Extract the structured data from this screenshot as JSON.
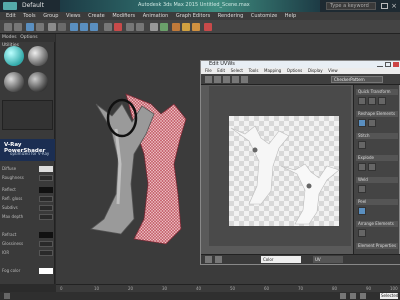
{
  "app": {
    "title": "Default",
    "window_title": "Autodesk 3ds Max 2015  Untitled_Scene.max",
    "search_placeholder": "Type a keyword"
  },
  "menubar": {
    "items": [
      "Edit",
      "Tools",
      "Group",
      "Views",
      "Create",
      "Modifiers",
      "Animation",
      "Graph Editors",
      "Rendering",
      "Customize",
      "Help"
    ]
  },
  "material_panel": {
    "tabs": [
      "Modes",
      "Options",
      "Utilities"
    ],
    "vray_title": "V-Ray PowerShader",
    "vray_subtitle": "optimized for V-Ray",
    "params": [
      "Diffuse",
      "Roughness",
      "Reflect",
      "Refl. gloss",
      "Subdivs",
      "Max depth",
      "Refract",
      "Glossiness",
      "IOR",
      "Fog color"
    ]
  },
  "uv_editor": {
    "title": "Edit UVWs",
    "menus": [
      "File",
      "Edit",
      "Select",
      "Tools",
      "Mapping",
      "Options",
      "Display",
      "View"
    ],
    "dropdown_value": "CheckerPattern",
    "status_value": "Color",
    "zoom_value": "UV",
    "side_sections": [
      "Quick Transform",
      "Reshape Elements",
      "Stitch",
      "Explode",
      "Weld",
      "Peel",
      "Arrange Elements",
      "Element Properties"
    ]
  },
  "timeline": {
    "ticks": [
      "0",
      "10",
      "20",
      "30",
      "40",
      "50",
      "60",
      "70",
      "80",
      "90",
      "100"
    ]
  },
  "statusbar": {
    "field": "Selected"
  },
  "colors": {
    "accent": "#3f8d80",
    "vray_blue": "#1b2e52",
    "model_red": "#b85360"
  }
}
